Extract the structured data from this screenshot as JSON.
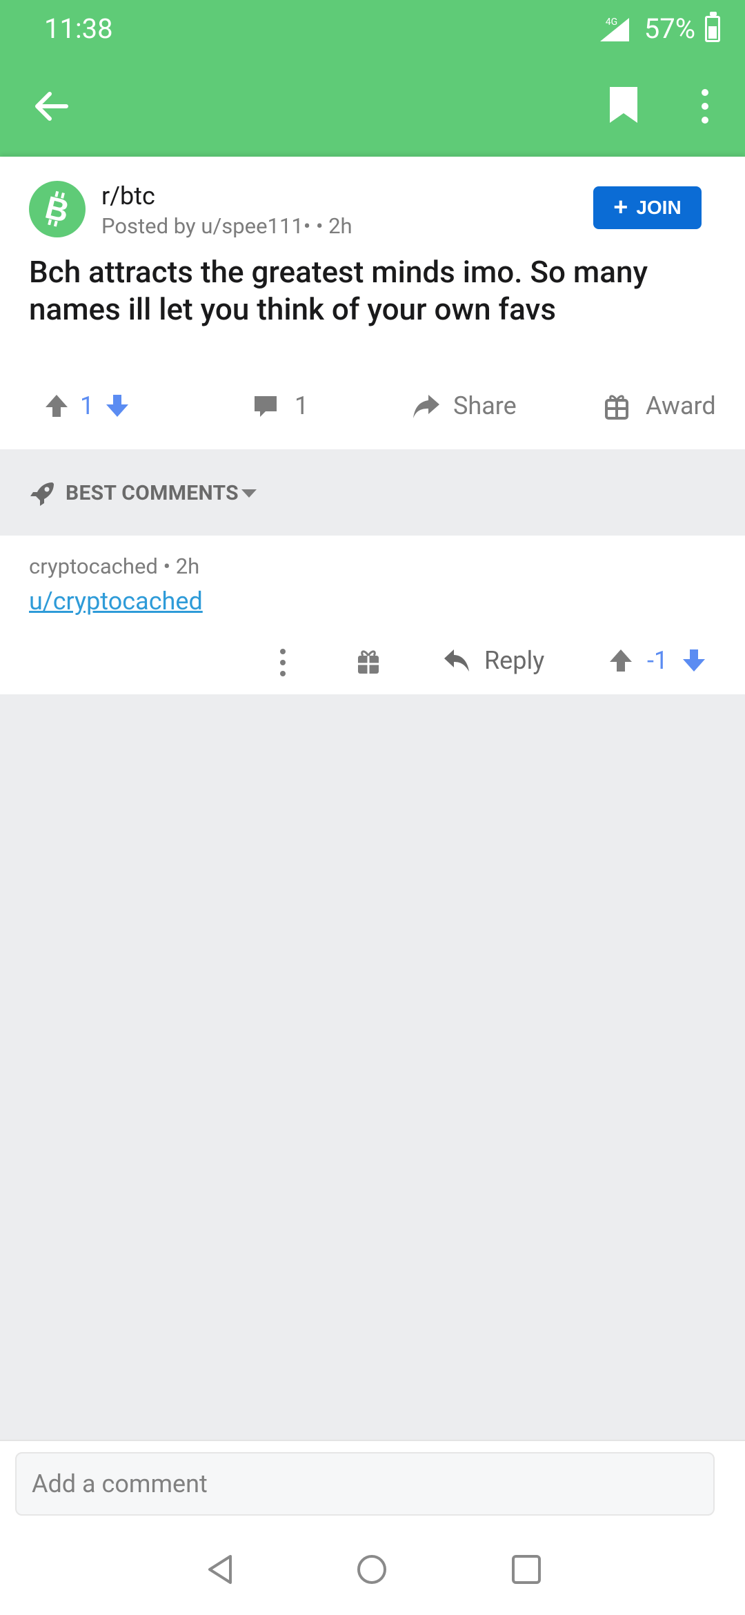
{
  "status_bar": {
    "time": "11:38",
    "network": "4G",
    "battery": "57%"
  },
  "post": {
    "subreddit": "r/btc",
    "posted_by": "Posted by u/spee111•  • 2h",
    "join_label": "JOIN",
    "title": "Bch attracts the greatest minds imo. So many names ill let you think of your own favs",
    "votes": "1",
    "comments": "1",
    "share_label": "Share",
    "award_label": "Award"
  },
  "sort": {
    "label": "BEST COMMENTS"
  },
  "comment": {
    "meta": "cryptocached • 2h",
    "body": "u/cryptocached",
    "reply_label": "Reply",
    "votes": "-1"
  },
  "composer": {
    "placeholder": "Add a comment"
  },
  "colors": {
    "header": "#5FCB77",
    "join": "#0B6CD5",
    "vote": "#5B8CF2",
    "link": "#2E9BD8"
  }
}
